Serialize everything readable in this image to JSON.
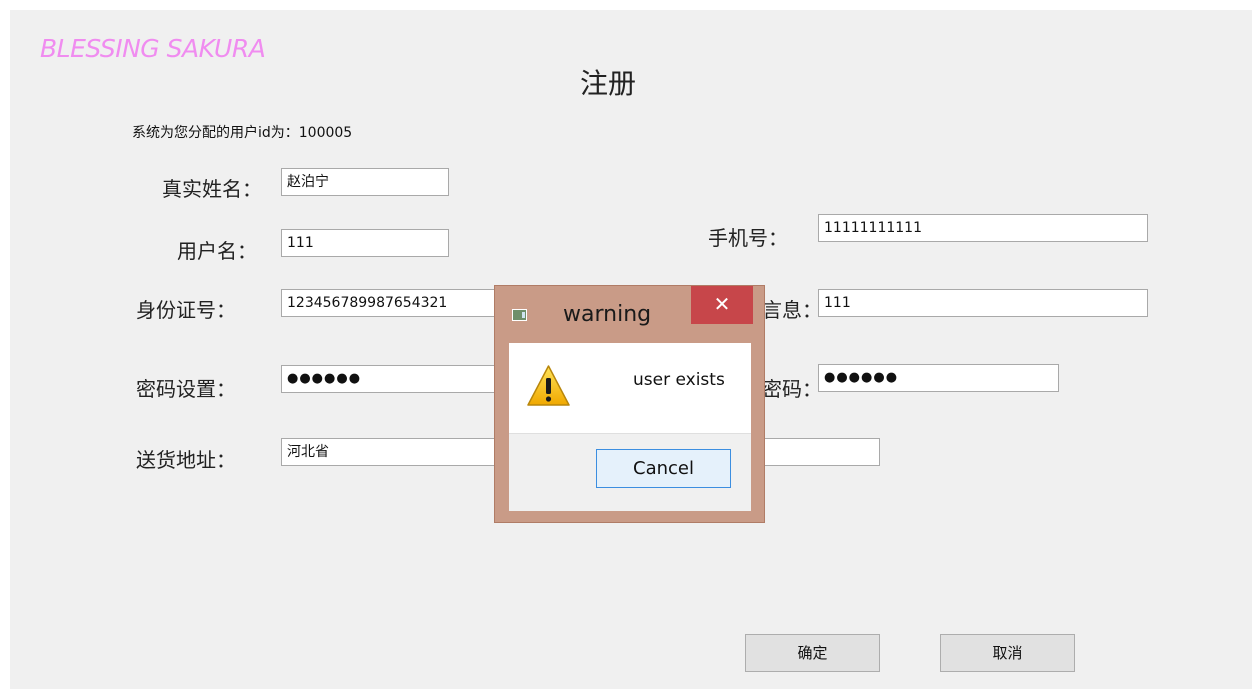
{
  "header": {
    "logo": "BLESSING SAKURA",
    "title": "注册",
    "userid_line": "系统为您分配的用户id为：100005"
  },
  "form": {
    "left": {
      "real_name": {
        "label": "真实姓名：",
        "value": "赵泊宁"
      },
      "username": {
        "label": "用户名：",
        "value": "111"
      },
      "id_number": {
        "label": "身份证号：",
        "value": "123456789987654321"
      },
      "password": {
        "label": "密码设置：",
        "value": "●●●●●●"
      },
      "address": {
        "label": "送货地址：",
        "value": "河北省"
      }
    },
    "right": {
      "phone": {
        "label": "手机号：",
        "value": "11111111111"
      },
      "info": {
        "label_visible": "言息：",
        "value": "111"
      },
      "confirm_password": {
        "label_visible": "密码：",
        "value": "●●●●●●"
      },
      "extra": {
        "value": ""
      }
    }
  },
  "buttons": {
    "confirm": "确定",
    "cancel": "取消"
  },
  "dialog": {
    "title": "warning",
    "close": "✕",
    "message": "user exists",
    "cancel": "Cancel"
  },
  "colors": {
    "logo": "#f08cf0",
    "dialog_frame": "#c99b87",
    "close_button": "#c7464a",
    "focus_border": "#3c8ee0"
  }
}
